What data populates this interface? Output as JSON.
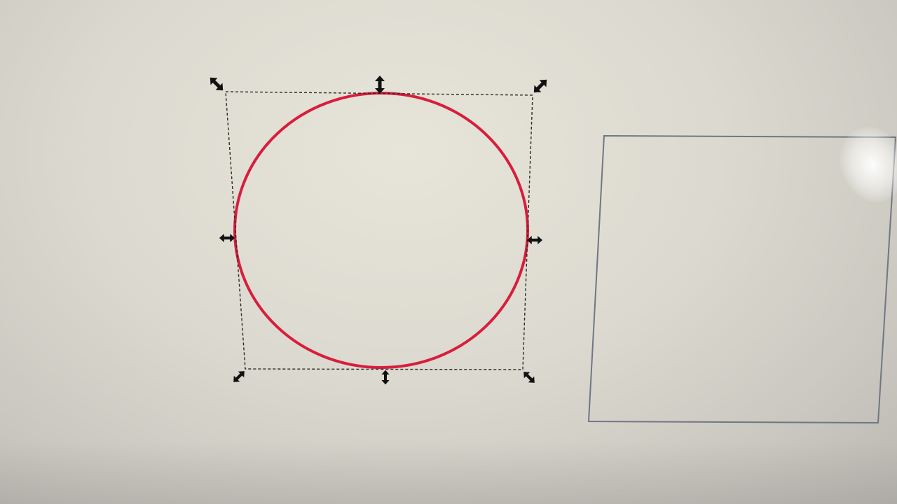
{
  "canvas": {
    "background_color": "#dddbd1"
  },
  "objects": [
    {
      "kind": "ellipse",
      "state": "selected",
      "stroke_color": "#d81e3c",
      "fill": "none"
    },
    {
      "kind": "rectangle",
      "state": "unselected",
      "stroke_color": "#6f7784",
      "fill": "none"
    }
  ],
  "selection": {
    "mode": "scale",
    "bbox_style": "dashed",
    "bbox_color": "#2a2a2a",
    "handle_color": "#111111",
    "handles": [
      {
        "name": "top-left",
        "icon": "resize-diagonal-nw-se-icon"
      },
      {
        "name": "top",
        "icon": "resize-vertical-icon"
      },
      {
        "name": "top-right",
        "icon": "resize-diagonal-ne-sw-icon"
      },
      {
        "name": "left",
        "icon": "resize-horizontal-icon"
      },
      {
        "name": "right",
        "icon": "resize-horizontal-icon"
      },
      {
        "name": "bottom-left",
        "icon": "resize-diagonal-ne-sw-icon"
      },
      {
        "name": "bottom",
        "icon": "resize-vertical-icon"
      },
      {
        "name": "bottom-right",
        "icon": "resize-diagonal-nw-se-icon"
      }
    ]
  }
}
